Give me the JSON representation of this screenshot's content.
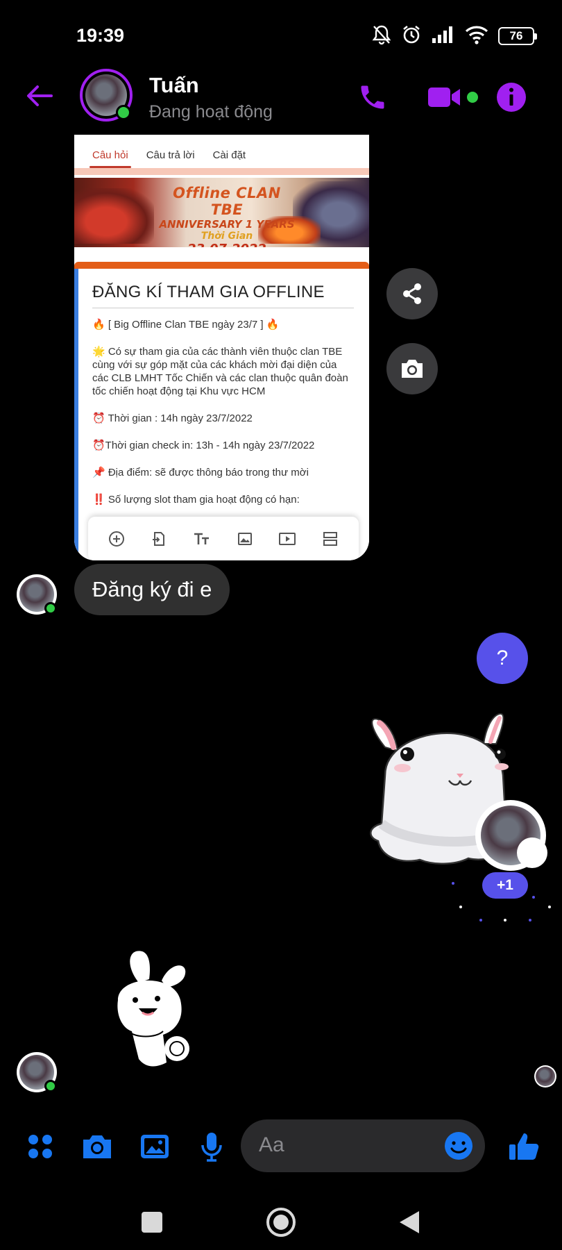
{
  "status_bar": {
    "time": "19:39",
    "battery": "76",
    "icons": [
      "bell-muted-icon",
      "alarm-icon",
      "signal-icon",
      "wifi-icon",
      "battery-icon"
    ]
  },
  "header": {
    "contact_name": "Tuấn",
    "contact_status": "Đang hoạt động",
    "accent_color": "#a020f0",
    "online_color": "#31cc46"
  },
  "shared_image": {
    "tabs": [
      "Câu hỏi",
      "Câu trả lời",
      "Cài đặt"
    ],
    "active_tab": "Câu hỏi",
    "banner": {
      "line1": "Offline CLAN TBE",
      "line2": "ANNIVERSARY 1 YEARS",
      "line3": "Thời Gian",
      "line4": "23.07.2022"
    },
    "form_title": "ĐĂNG KÍ THAM GIA OFFLINE",
    "lines": [
      "🔥 [ Big Offline Clan TBE ngày 23/7 ] 🔥",
      "🌟 Có sự tham gia của các thành viên thuộc clan TBE cùng với sự góp mặt của các khách mời đại diện của các CLB LMHT Tốc Chiến và các clan thuộc quân đoàn tốc chiến hoạt động tại Khu vực HCM",
      "⏰ Thời gian : 14h ngày 23/7/2022",
      "⏰Thời gian check in: 13h - 14h ngày 23/7/2022",
      "📌 Địa điểm: sẽ được thông báo trong thư mời",
      "‼️ Số lượng slot tham gia hoạt động có hạn:"
    ],
    "toolbar_icons": [
      "add-question-icon",
      "import-icon",
      "title-text-icon",
      "image-icon",
      "video-icon",
      "section-icon"
    ]
  },
  "messages": {
    "incoming_text": "Đăng ký đi e",
    "outgoing_question": "?",
    "reaction_emoji": "😆",
    "reaction_count": "+1"
  },
  "composer": {
    "placeholder": "Aa",
    "icon_color": "#1877f2"
  }
}
